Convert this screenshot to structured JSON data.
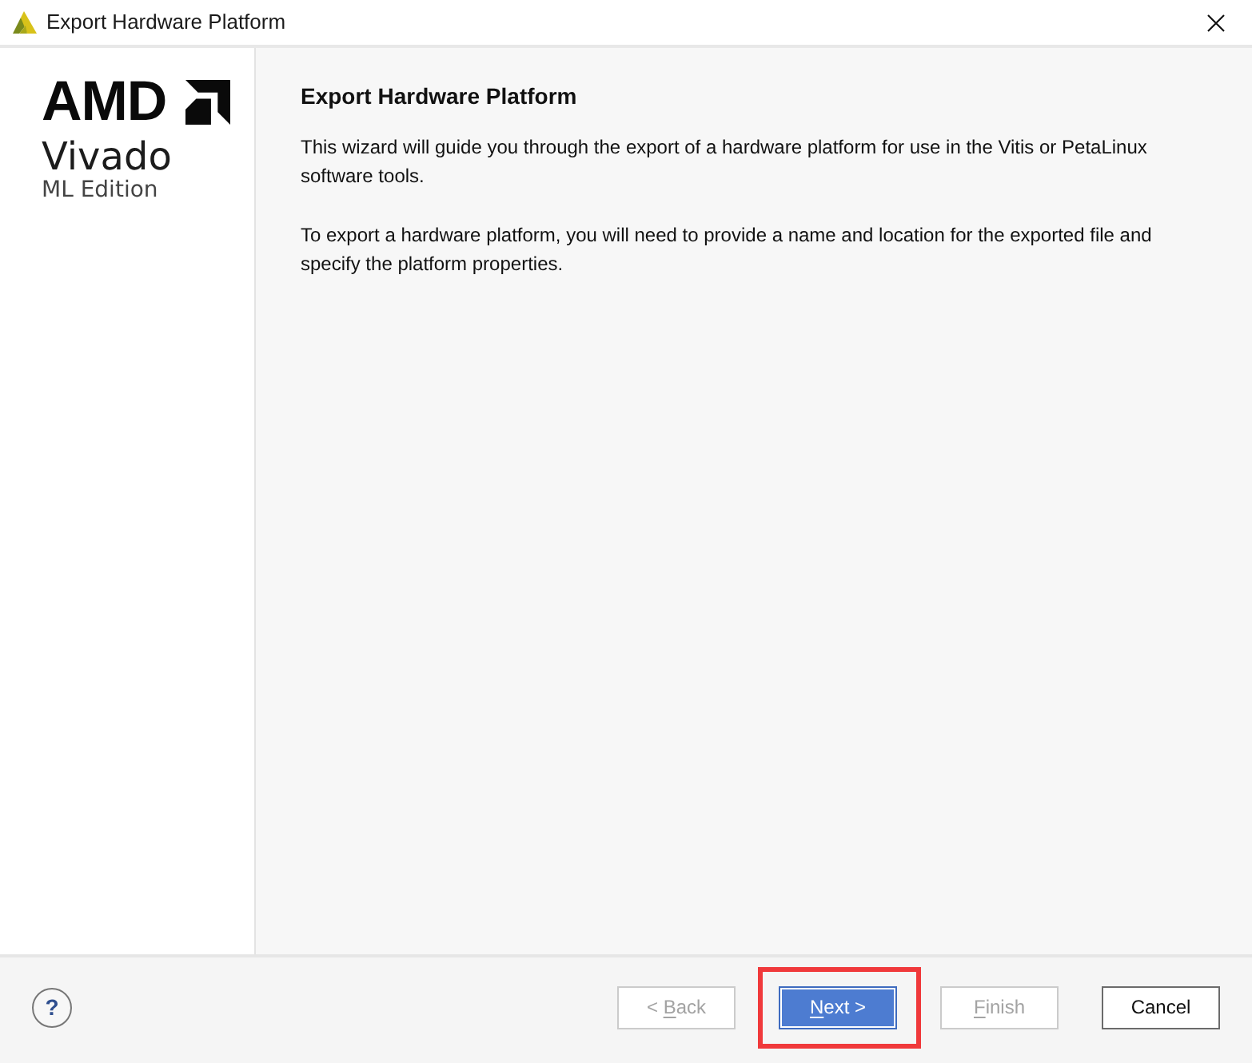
{
  "window": {
    "title": "Export Hardware Platform"
  },
  "sidebar": {
    "brand": "AMD",
    "product": "Vivado",
    "edition": "ML Edition"
  },
  "page": {
    "heading": "Export Hardware Platform",
    "paragraphs": [
      "This wizard will guide you through the export of a hardware platform for use in the Vitis or PetaLinux software tools.",
      "To export a hardware platform, you will need to provide a name and location for the exported file and specify the platform properties."
    ]
  },
  "footer": {
    "help": {
      "label": "?"
    },
    "buttons": [
      {
        "label": "< Back",
        "access_key_underlined": true,
        "disabled": true,
        "default": false,
        "highlighted": false
      },
      {
        "label": "Next >",
        "access_key_underlined": true,
        "disabled": false,
        "default": true,
        "highlighted": true
      },
      {
        "label": "Finish",
        "access_key_underlined": true,
        "disabled": true,
        "default": false,
        "highlighted": false
      },
      {
        "label": "Cancel",
        "access_key_underlined": false,
        "disabled": false,
        "default": false,
        "highlighted": false
      }
    ]
  }
}
